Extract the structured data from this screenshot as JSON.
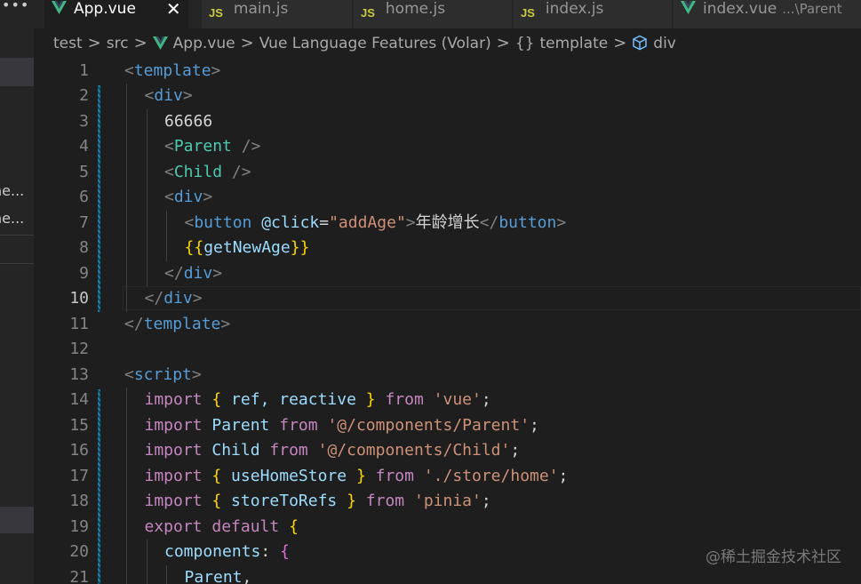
{
  "sidebar": {
    "menu_label": "•••",
    "items": [
      "ne...",
      "ne..."
    ]
  },
  "tabs": [
    {
      "label": "App.vue",
      "type": "vue",
      "active": true,
      "close": "✕"
    },
    {
      "label": "main.js",
      "type": "js",
      "active": false
    },
    {
      "label": "home.js",
      "type": "js",
      "active": false
    },
    {
      "label": "index.js",
      "type": "js",
      "active": false
    },
    {
      "label": "index.vue",
      "type": "vue",
      "active": false,
      "hint": "...\\Parent"
    }
  ],
  "js_icon_text": "JS",
  "breadcrumb": {
    "items": [
      "test",
      "src",
      "App.vue",
      "Vue Language Features (Volar)",
      "template",
      "div"
    ],
    "separator": ">",
    "braces": "{}"
  },
  "editor": {
    "current_line": 10,
    "lines": [
      {
        "n": "1",
        "segs": [
          [
            "<",
            "punc"
          ],
          [
            "template",
            "tag"
          ],
          [
            ">",
            "punc"
          ]
        ],
        "indent": 0
      },
      {
        "n": "2",
        "segs": [
          [
            "<",
            "punc"
          ],
          [
            "div",
            "tag"
          ],
          [
            ">",
            "punc"
          ]
        ],
        "indent": 1
      },
      {
        "n": "3",
        "segs": [
          [
            "66666",
            "text"
          ]
        ],
        "indent": 2
      },
      {
        "n": "4",
        "segs": [
          [
            "<",
            "punc"
          ],
          [
            "Parent",
            "comp"
          ],
          [
            " />",
            "punc"
          ]
        ],
        "indent": 2
      },
      {
        "n": "5",
        "segs": [
          [
            "<",
            "punc"
          ],
          [
            "Child",
            "comp"
          ],
          [
            " />",
            "punc"
          ]
        ],
        "indent": 2
      },
      {
        "n": "6",
        "segs": [
          [
            "<",
            "punc"
          ],
          [
            "div",
            "tag"
          ],
          [
            ">",
            "punc"
          ]
        ],
        "indent": 2
      },
      {
        "n": "7",
        "segs": [
          [
            "<",
            "punc"
          ],
          [
            "button",
            "tag"
          ],
          [
            " ",
            "text"
          ],
          [
            "@click",
            "attr"
          ],
          [
            "=",
            "text"
          ],
          [
            "\"addAge\"",
            "str"
          ],
          [
            ">",
            "punc"
          ],
          [
            "年龄增长",
            "text"
          ],
          [
            "</",
            "punc"
          ],
          [
            "button",
            "tag"
          ],
          [
            ">",
            "punc"
          ]
        ],
        "indent": 3
      },
      {
        "n": "8",
        "segs": [
          [
            "{{",
            "brace"
          ],
          [
            "getNewAge",
            "var"
          ],
          [
            "}}",
            "brace"
          ]
        ],
        "indent": 3
      },
      {
        "n": "9",
        "segs": [
          [
            "</",
            "punc"
          ],
          [
            "div",
            "tag"
          ],
          [
            ">",
            "punc"
          ]
        ],
        "indent": 2
      },
      {
        "n": "10",
        "segs": [
          [
            "</",
            "punc"
          ],
          [
            "div",
            "tag"
          ],
          [
            ">",
            "punc"
          ]
        ],
        "indent": 1
      },
      {
        "n": "11",
        "segs": [
          [
            "</",
            "punc"
          ],
          [
            "template",
            "tag"
          ],
          [
            ">",
            "punc"
          ]
        ],
        "indent": 0
      },
      {
        "n": "12",
        "segs": [],
        "indent": 0
      },
      {
        "n": "13",
        "segs": [
          [
            "<",
            "punc"
          ],
          [
            "script",
            "tag"
          ],
          [
            ">",
            "punc"
          ]
        ],
        "indent": 0
      },
      {
        "n": "14",
        "segs": [
          [
            "import",
            "kw"
          ],
          [
            " ",
            "text"
          ],
          [
            "{",
            "brace"
          ],
          [
            " ref, reactive ",
            "var"
          ],
          [
            "}",
            "brace"
          ],
          [
            " ",
            "text"
          ],
          [
            "from",
            "kw"
          ],
          [
            " ",
            "text"
          ],
          [
            "'vue'",
            "str"
          ],
          [
            ";",
            "text"
          ]
        ],
        "indent": 1,
        "dim": true
      },
      {
        "n": "15",
        "segs": [
          [
            "import",
            "kw"
          ],
          [
            " ",
            "text"
          ],
          [
            "Parent",
            "var"
          ],
          [
            " ",
            "text"
          ],
          [
            "from",
            "kw"
          ],
          [
            " ",
            "text"
          ],
          [
            "'@/components/Parent'",
            "str"
          ],
          [
            ";",
            "text"
          ]
        ],
        "indent": 1
      },
      {
        "n": "16",
        "segs": [
          [
            "import",
            "kw"
          ],
          [
            " ",
            "text"
          ],
          [
            "Child",
            "var"
          ],
          [
            " ",
            "text"
          ],
          [
            "from",
            "kw"
          ],
          [
            " ",
            "text"
          ],
          [
            "'@/components/Child'",
            "str"
          ],
          [
            ";",
            "text"
          ]
        ],
        "indent": 1
      },
      {
        "n": "17",
        "segs": [
          [
            "import",
            "kw"
          ],
          [
            " ",
            "text"
          ],
          [
            "{",
            "brace"
          ],
          [
            " useHomeStore ",
            "var"
          ],
          [
            "}",
            "brace"
          ],
          [
            " ",
            "text"
          ],
          [
            "from",
            "kw"
          ],
          [
            " ",
            "text"
          ],
          [
            "'./store/home'",
            "str"
          ],
          [
            ";",
            "text"
          ]
        ],
        "indent": 1
      },
      {
        "n": "18",
        "segs": [
          [
            "import",
            "kw"
          ],
          [
            " ",
            "text"
          ],
          [
            "{",
            "brace"
          ],
          [
            " storeToRefs ",
            "var"
          ],
          [
            "}",
            "brace"
          ],
          [
            " ",
            "text"
          ],
          [
            "from",
            "kw"
          ],
          [
            " ",
            "text"
          ],
          [
            "'pinia'",
            "str"
          ],
          [
            ";",
            "text"
          ]
        ],
        "indent": 1
      },
      {
        "n": "19",
        "segs": [
          [
            "export",
            "kw"
          ],
          [
            " ",
            "text"
          ],
          [
            "default",
            "kw"
          ],
          [
            " ",
            "text"
          ],
          [
            "{",
            "brace"
          ]
        ],
        "indent": 1
      },
      {
        "n": "20",
        "segs": [
          [
            "components",
            "var"
          ],
          [
            ": ",
            "text"
          ],
          [
            "{",
            "brace2"
          ]
        ],
        "indent": 2
      },
      {
        "n": "21",
        "segs": [
          [
            "Parent",
            "var"
          ],
          [
            ",",
            "text"
          ]
        ],
        "indent": 3
      }
    ]
  },
  "watermark": "@稀土掘金技术社区",
  "colors": {
    "background": "#1e1e1e",
    "tab_inactive": "#2d2d2d",
    "sidebar": "#252526",
    "vue_green": "#41b883",
    "js_yellow": "#cbcb41",
    "cube_blue": "#75beff"
  }
}
